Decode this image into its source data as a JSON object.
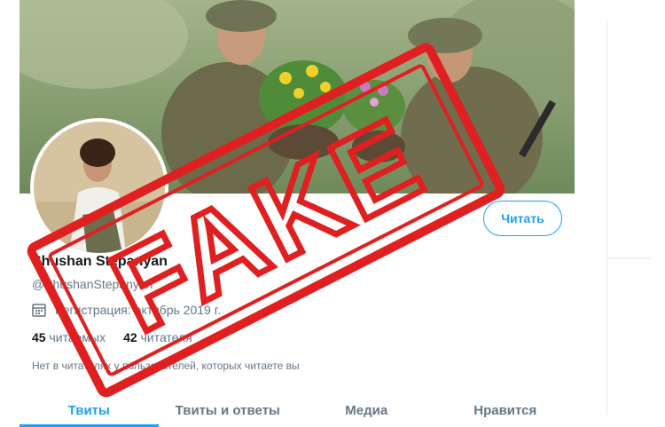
{
  "profile": {
    "name": "Shushan Stepanyan",
    "handle": "@ShushanStepanyan",
    "joined": "Регистрация: октябрь 2019 г.",
    "following_count": "45",
    "following_label": "читаемых",
    "followers_count": "42",
    "followers_label": "читателя",
    "no_common_followers": "Нет в читателях у пользователей, которых читаете вы"
  },
  "actions": {
    "more_icon": "ellipsis-icon",
    "follow_label": "Читать"
  },
  "tabs": [
    {
      "label": "Твиты",
      "active": true
    },
    {
      "label": "Твиты и ответы",
      "active": false
    },
    {
      "label": "Медиа",
      "active": false
    },
    {
      "label": "Нравится",
      "active": false
    }
  ],
  "overlay": {
    "stamp_text": "FAKE"
  },
  "colors": {
    "accent": "#1da1f2",
    "stamp": "#e02020"
  }
}
